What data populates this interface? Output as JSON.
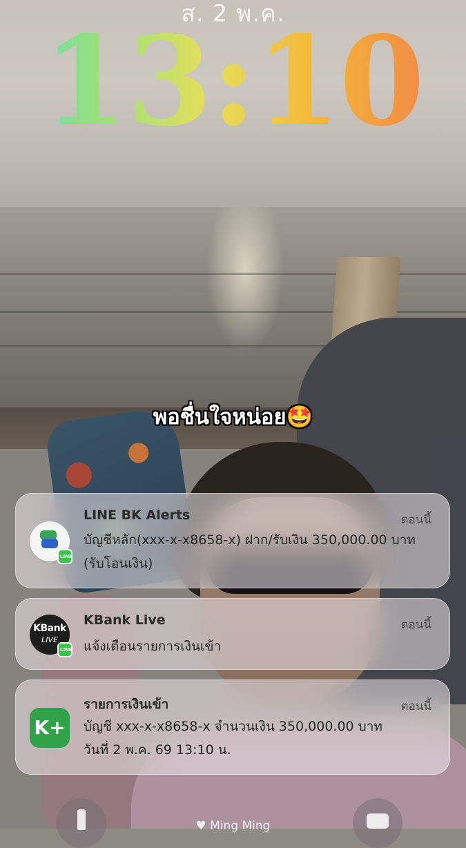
{
  "lockscreen": {
    "date": "ส. 2 พ.ค.",
    "time": "13:10",
    "caption": "พอชื่นใจหน่อย🤩",
    "owner": "Ming Ming"
  },
  "notifications": [
    {
      "app": "LINE BK Alerts",
      "time": "ตอนนี้",
      "message": "บัญชีหลัก(xxx-x-x8658-x) ฝาก/รับเงิน 350,000.00 บาท (รับโอนเงิน)",
      "icon": "line-bk-icon"
    },
    {
      "app": "KBank Live",
      "time": "ตอนนี้",
      "message": "แจ้งเตือนรายการเงินเข้า",
      "icon": "kbank-live-icon",
      "icon_text": [
        "KBank",
        "LIVE"
      ]
    },
    {
      "app": "รายการเงินเข้า",
      "time": "ตอนนี้",
      "message_line1": "บัญชี xxx-x-x8658-x  จำนวนเงิน 350,000.00 บาท",
      "message_line2": "วันที่ 2 พ.ค. 69  13:10 น.",
      "icon": "k-plus-icon",
      "icon_text": "K+"
    }
  ],
  "badge_text": "LINE",
  "colors": {
    "clock_gradient": [
      "#5fe0c2",
      "#9be07a",
      "#e6df5a",
      "#f5b73a",
      "#f07a4a"
    ],
    "line_green": "#38c34a",
    "kplus_green": "#2fa24a"
  }
}
